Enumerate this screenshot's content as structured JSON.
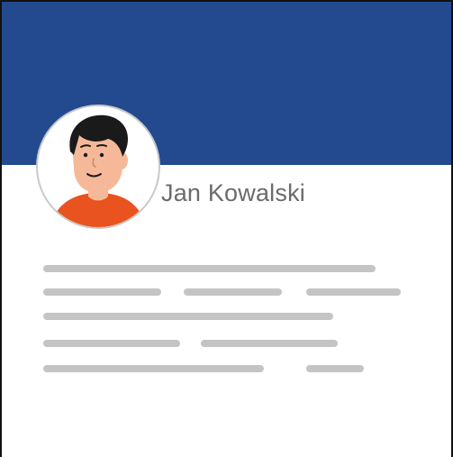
{
  "profile": {
    "name": "Jan Kowalski"
  },
  "colors": {
    "header": "#234a8f",
    "placeholder_text": "#c4c4c4",
    "name_text": "#6b6b6b",
    "shirt": "#e8531f",
    "skin": "#f5b99a",
    "hair": "#1a1a1a"
  },
  "icons": {
    "avatar": "user-avatar-illustration"
  }
}
